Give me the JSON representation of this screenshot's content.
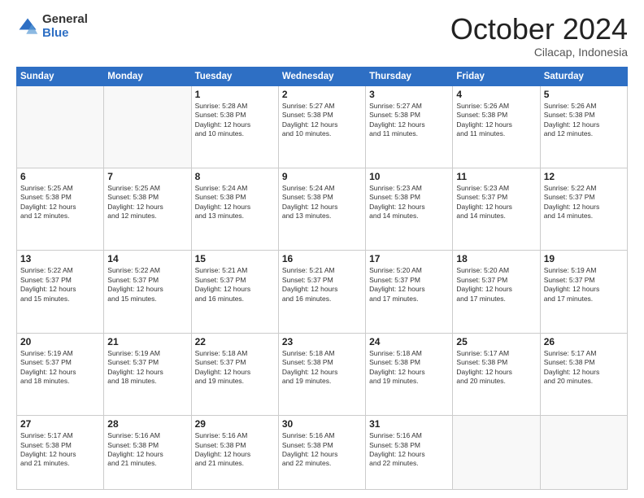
{
  "header": {
    "logo_general": "General",
    "logo_blue": "Blue",
    "month": "October 2024",
    "location": "Cilacap, Indonesia"
  },
  "weekdays": [
    "Sunday",
    "Monday",
    "Tuesday",
    "Wednesday",
    "Thursday",
    "Friday",
    "Saturday"
  ],
  "weeks": [
    [
      {
        "day": "",
        "info": ""
      },
      {
        "day": "",
        "info": ""
      },
      {
        "day": "1",
        "info": "Sunrise: 5:28 AM\nSunset: 5:38 PM\nDaylight: 12 hours\nand 10 minutes."
      },
      {
        "day": "2",
        "info": "Sunrise: 5:27 AM\nSunset: 5:38 PM\nDaylight: 12 hours\nand 10 minutes."
      },
      {
        "day": "3",
        "info": "Sunrise: 5:27 AM\nSunset: 5:38 PM\nDaylight: 12 hours\nand 11 minutes."
      },
      {
        "day": "4",
        "info": "Sunrise: 5:26 AM\nSunset: 5:38 PM\nDaylight: 12 hours\nand 11 minutes."
      },
      {
        "day": "5",
        "info": "Sunrise: 5:26 AM\nSunset: 5:38 PM\nDaylight: 12 hours\nand 12 minutes."
      }
    ],
    [
      {
        "day": "6",
        "info": "Sunrise: 5:25 AM\nSunset: 5:38 PM\nDaylight: 12 hours\nand 12 minutes."
      },
      {
        "day": "7",
        "info": "Sunrise: 5:25 AM\nSunset: 5:38 PM\nDaylight: 12 hours\nand 12 minutes."
      },
      {
        "day": "8",
        "info": "Sunrise: 5:24 AM\nSunset: 5:38 PM\nDaylight: 12 hours\nand 13 minutes."
      },
      {
        "day": "9",
        "info": "Sunrise: 5:24 AM\nSunset: 5:38 PM\nDaylight: 12 hours\nand 13 minutes."
      },
      {
        "day": "10",
        "info": "Sunrise: 5:23 AM\nSunset: 5:38 PM\nDaylight: 12 hours\nand 14 minutes."
      },
      {
        "day": "11",
        "info": "Sunrise: 5:23 AM\nSunset: 5:37 PM\nDaylight: 12 hours\nand 14 minutes."
      },
      {
        "day": "12",
        "info": "Sunrise: 5:22 AM\nSunset: 5:37 PM\nDaylight: 12 hours\nand 14 minutes."
      }
    ],
    [
      {
        "day": "13",
        "info": "Sunrise: 5:22 AM\nSunset: 5:37 PM\nDaylight: 12 hours\nand 15 minutes."
      },
      {
        "day": "14",
        "info": "Sunrise: 5:22 AM\nSunset: 5:37 PM\nDaylight: 12 hours\nand 15 minutes."
      },
      {
        "day": "15",
        "info": "Sunrise: 5:21 AM\nSunset: 5:37 PM\nDaylight: 12 hours\nand 16 minutes."
      },
      {
        "day": "16",
        "info": "Sunrise: 5:21 AM\nSunset: 5:37 PM\nDaylight: 12 hours\nand 16 minutes."
      },
      {
        "day": "17",
        "info": "Sunrise: 5:20 AM\nSunset: 5:37 PM\nDaylight: 12 hours\nand 17 minutes."
      },
      {
        "day": "18",
        "info": "Sunrise: 5:20 AM\nSunset: 5:37 PM\nDaylight: 12 hours\nand 17 minutes."
      },
      {
        "day": "19",
        "info": "Sunrise: 5:19 AM\nSunset: 5:37 PM\nDaylight: 12 hours\nand 17 minutes."
      }
    ],
    [
      {
        "day": "20",
        "info": "Sunrise: 5:19 AM\nSunset: 5:37 PM\nDaylight: 12 hours\nand 18 minutes."
      },
      {
        "day": "21",
        "info": "Sunrise: 5:19 AM\nSunset: 5:37 PM\nDaylight: 12 hours\nand 18 minutes."
      },
      {
        "day": "22",
        "info": "Sunrise: 5:18 AM\nSunset: 5:37 PM\nDaylight: 12 hours\nand 19 minutes."
      },
      {
        "day": "23",
        "info": "Sunrise: 5:18 AM\nSunset: 5:38 PM\nDaylight: 12 hours\nand 19 minutes."
      },
      {
        "day": "24",
        "info": "Sunrise: 5:18 AM\nSunset: 5:38 PM\nDaylight: 12 hours\nand 19 minutes."
      },
      {
        "day": "25",
        "info": "Sunrise: 5:17 AM\nSunset: 5:38 PM\nDaylight: 12 hours\nand 20 minutes."
      },
      {
        "day": "26",
        "info": "Sunrise: 5:17 AM\nSunset: 5:38 PM\nDaylight: 12 hours\nand 20 minutes."
      }
    ],
    [
      {
        "day": "27",
        "info": "Sunrise: 5:17 AM\nSunset: 5:38 PM\nDaylight: 12 hours\nand 21 minutes."
      },
      {
        "day": "28",
        "info": "Sunrise: 5:16 AM\nSunset: 5:38 PM\nDaylight: 12 hours\nand 21 minutes."
      },
      {
        "day": "29",
        "info": "Sunrise: 5:16 AM\nSunset: 5:38 PM\nDaylight: 12 hours\nand 21 minutes."
      },
      {
        "day": "30",
        "info": "Sunrise: 5:16 AM\nSunset: 5:38 PM\nDaylight: 12 hours\nand 22 minutes."
      },
      {
        "day": "31",
        "info": "Sunrise: 5:16 AM\nSunset: 5:38 PM\nDaylight: 12 hours\nand 22 minutes."
      },
      {
        "day": "",
        "info": ""
      },
      {
        "day": "",
        "info": ""
      }
    ]
  ]
}
